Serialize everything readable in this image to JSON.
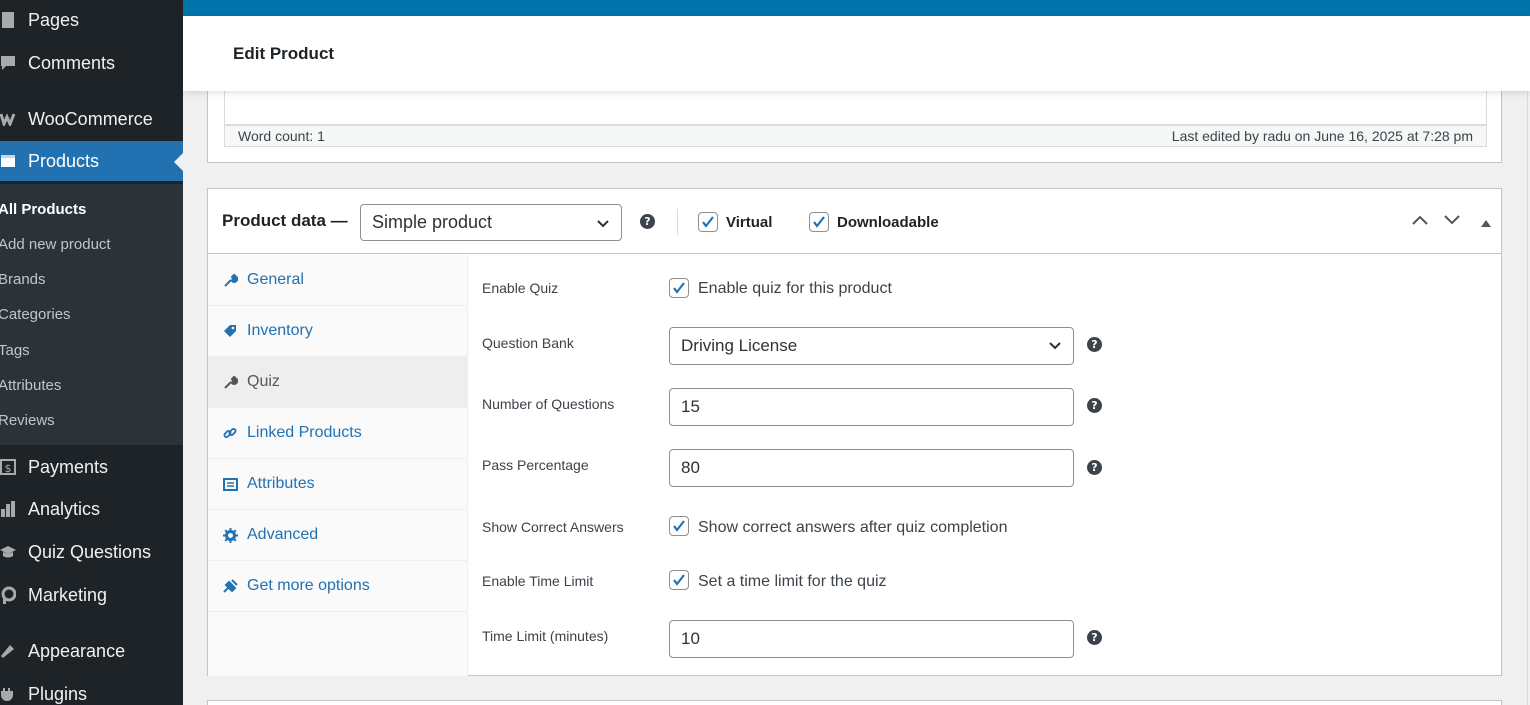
{
  "sidebar": {
    "items": [
      {
        "label": "Pages",
        "icon": "pages-icon"
      },
      {
        "label": "Comments",
        "icon": "comments-icon"
      },
      {
        "label": "WooCommerce",
        "icon": "woocommerce-icon"
      },
      {
        "label": "Products",
        "icon": "products-icon"
      },
      {
        "label": "Payments",
        "icon": "payments-icon"
      },
      {
        "label": "Analytics",
        "icon": "analytics-icon"
      },
      {
        "label": "Quiz Questions",
        "icon": "quiz-icon"
      },
      {
        "label": "Marketing",
        "icon": "marketing-icon"
      },
      {
        "label": "Appearance",
        "icon": "appearance-icon"
      },
      {
        "label": "Plugins",
        "icon": "plugins-icon"
      }
    ],
    "submenu": [
      "All Products",
      "Add new product",
      "Brands",
      "Categories",
      "Tags",
      "Attributes",
      "Reviews"
    ],
    "accent": "#2271b1"
  },
  "header": {
    "title": "Edit Product"
  },
  "editor": {
    "word_count": "Word count: 1",
    "last_edited": "Last edited by radu on June 16, 2025 at 7:28 pm"
  },
  "product_data": {
    "title": "Product data —",
    "type_selected": "Simple product",
    "virtual_label": "Virtual",
    "virtual_checked": true,
    "downloadable_label": "Downloadable",
    "downloadable_checked": true,
    "tabs": [
      {
        "label": "General",
        "icon": "wrench-icon"
      },
      {
        "label": "Inventory",
        "icon": "tag-icon"
      },
      {
        "label": "Quiz",
        "icon": "wrench-icon"
      },
      {
        "label": "Linked Products",
        "icon": "link-icon"
      },
      {
        "label": "Attributes",
        "icon": "list-icon"
      },
      {
        "label": "Advanced",
        "icon": "gear-icon"
      },
      {
        "label": "Get more options",
        "icon": "plugin-icon"
      }
    ],
    "active_tab": "Quiz"
  },
  "quiz": {
    "enable_quiz": {
      "label": "Enable Quiz",
      "checkbox_label": "Enable quiz for this product",
      "checked": true
    },
    "question_bank": {
      "label": "Question Bank",
      "value": "Driving License"
    },
    "num_questions": {
      "label": "Number of Questions",
      "value": "15"
    },
    "pass_percentage": {
      "label": "Pass Percentage",
      "value": "80"
    },
    "show_answers": {
      "label": "Show Correct Answers",
      "checkbox_label": "Show correct answers after quiz completion",
      "checked": true
    },
    "time_limit_enable": {
      "label": "Enable Time Limit",
      "checkbox_label": "Set a time limit for the quiz",
      "checked": true
    },
    "time_limit": {
      "label": "Time Limit (minutes)",
      "value": "10"
    }
  }
}
